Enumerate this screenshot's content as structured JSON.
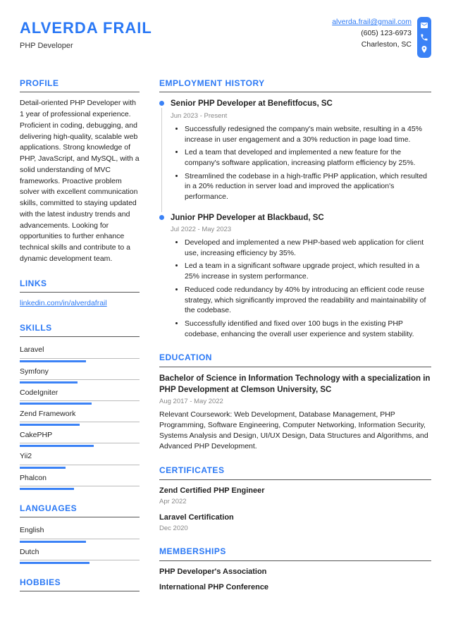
{
  "header": {
    "name": "ALVERDA FRAIL",
    "title": "PHP Developer",
    "email": "alverda.frail@gmail.com",
    "phone": "(605) 123-6973",
    "location": "Charleston, SC"
  },
  "sections": {
    "profile": "PROFILE",
    "links": "LINKS",
    "skills": "SKILLS",
    "languages": "LANGUAGES",
    "hobbies": "HOBBIES",
    "employment": "EMPLOYMENT HISTORY",
    "education": "EDUCATION",
    "certificates": "CERTIFICATES",
    "memberships": "MEMBERSHIPS"
  },
  "profile_text": "Detail-oriented PHP Developer with 1 year of professional experience. Proficient in coding, debugging, and delivering high-quality, scalable web applications. Strong knowledge of PHP, JavaScript, and MySQL, with a solid understanding of MVC frameworks. Proactive problem solver with excellent communication skills, committed to staying updated with the latest industry trends and advancements. Looking for opportunities to further enhance technical skills and contribute to a dynamic development team.",
  "link": "linkedin.com/in/alverdafrail",
  "skills": [
    {
      "name": "Laravel",
      "level": 55
    },
    {
      "name": "Symfony",
      "level": 48
    },
    {
      "name": "CodeIgniter",
      "level": 60
    },
    {
      "name": "Zend Framework",
      "level": 50
    },
    {
      "name": "CakePHP",
      "level": 62
    },
    {
      "name": "Yii2",
      "level": 38
    },
    {
      "name": "Phalcon",
      "level": 45
    }
  ],
  "languages": [
    {
      "name": "English",
      "level": 55
    },
    {
      "name": "Dutch",
      "level": 58
    }
  ],
  "jobs": [
    {
      "title": "Senior PHP Developer at Benefitfocus, SC",
      "date": "Jun 2023 - Present",
      "bullets": [
        "Successfully redesigned the company's main website, resulting in a 45% increase in user engagement and a 30% reduction in page load time.",
        "Led a team that developed and implemented a new feature for the company's software application, increasing platform efficiency by 25%.",
        "Streamlined the codebase in a high-traffic PHP application, which resulted in a 20% reduction in server load and improved the application's performance."
      ]
    },
    {
      "title": "Junior PHP Developer at Blackbaud, SC",
      "date": "Jul 2022 - May 2023",
      "bullets": [
        "Developed and implemented a new PHP-based web application for client use, increasing efficiency by 35%.",
        "Led a team in a significant software upgrade project, which resulted in a 25% increase in system performance.",
        "Reduced code redundancy by 40% by introducing an efficient code reuse strategy, which significantly improved the readability and maintainability of the codebase.",
        "Successfully identified and fixed over 100 bugs in the existing PHP codebase, enhancing the overall user experience and system stability."
      ]
    }
  ],
  "education": {
    "title": "Bachelor of Science in Information Technology with a specialization in PHP Development at Clemson University, SC",
    "date": "Aug 2017 - May 2022",
    "text": "Relevant Coursework: Web Development, Database Management, PHP Programming, Software Engineering, Computer Networking, Information Security, Systems Analysis and Design, UI/UX Design, Data Structures and Algorithms, and Advanced PHP Development."
  },
  "certificates": [
    {
      "name": "Zend Certified PHP Engineer",
      "date": "Apr 2022"
    },
    {
      "name": "Laravel Certification",
      "date": "Dec 2020"
    }
  ],
  "memberships": [
    "PHP Developer's Association",
    "International PHP Conference"
  ]
}
